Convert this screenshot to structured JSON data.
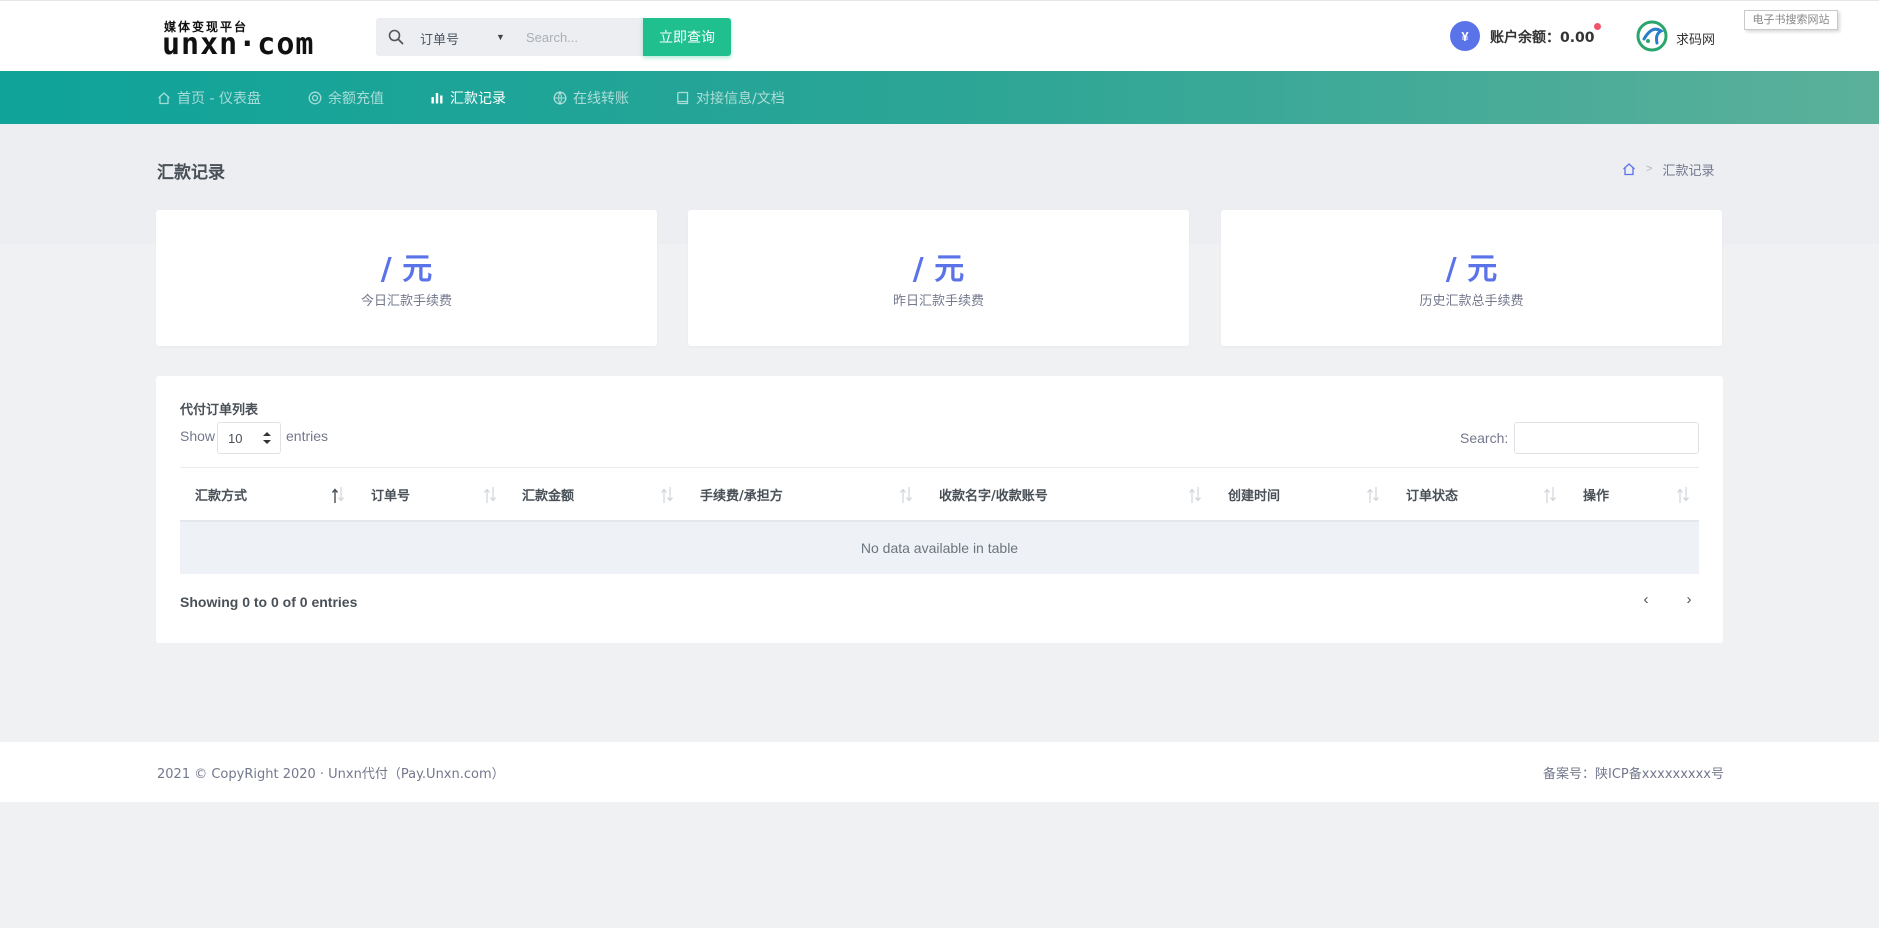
{
  "header": {
    "logo_sub": "媒体变现平台",
    "logo_main": "unxn·com",
    "search_type": "订单号",
    "search_placeholder": "Search...",
    "query_button": "立即查询",
    "balance_label": "账户余额：",
    "balance_value": "0.00",
    "balance_icon": "¥",
    "brand2_label": "求码网",
    "float_tag": "电子书搜索网站"
  },
  "nav": {
    "items": [
      {
        "label": "首页 - 仪表盘",
        "icon": "home-icon"
      },
      {
        "label": "余额充值",
        "icon": "coin-icon"
      },
      {
        "label": "汇款记录",
        "icon": "bar-chart-icon",
        "active": true
      },
      {
        "label": "在线转账",
        "icon": "globe-icon"
      },
      {
        "label": "对接信息/文档",
        "icon": "book-icon"
      }
    ]
  },
  "page": {
    "title": "汇款记录",
    "breadcrumb_current": "汇款记录"
  },
  "stats": [
    {
      "value": "/ 元",
      "label": "今日汇款手续费"
    },
    {
      "value": "/ 元",
      "label": "昨日汇款手续费"
    },
    {
      "value": "/ 元",
      "label": "历史汇款总手续费"
    }
  ],
  "table": {
    "title": "代付订单列表",
    "show_label": "Show",
    "entries_label": "entries",
    "length_value": "10",
    "search_label": "Search:",
    "columns": [
      "汇款方式",
      "订单号",
      "汇款金额",
      "手续费/承担方",
      "收款名字/收款账号",
      "创建时间",
      "订单状态",
      "操作"
    ],
    "empty_text": "No data available in table",
    "info_text": "Showing 0 to 0 of 0 entries",
    "prev": "‹",
    "next": "›"
  },
  "footer": {
    "left": "2021 © CopyRight 2020 · Unxn代付（Pay.Unxn.com）",
    "right": "备案号：陕ICP备xxxxxxxxx号"
  },
  "colors": {
    "accent": "#5b73e8",
    "button_green": "#1fc08e",
    "nav_start": "#0fa39a",
    "nav_end": "#5bb09a",
    "notify": "#f1556c"
  }
}
